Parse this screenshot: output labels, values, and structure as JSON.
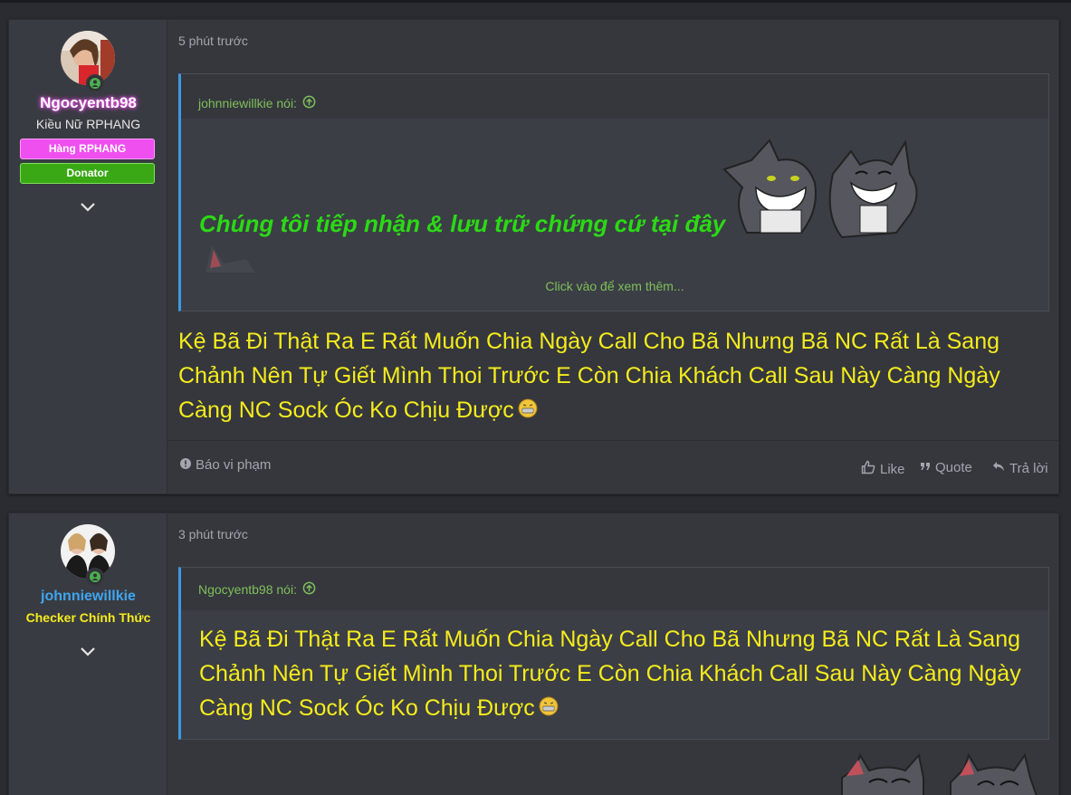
{
  "post1": {
    "time": "5 phút trước",
    "user": {
      "name": "Ngocyentb98",
      "title": "Kiều Nữ RPHANG",
      "banners": [
        "Hàng RPHANG",
        "Donator"
      ]
    },
    "quote": {
      "author": "johnniewillkie nói:",
      "text": "Chúng tôi tiếp nhận & lưu trữ chứng cứ tại đây",
      "expand": "Click vào để xem thêm..."
    },
    "body": "Kệ Bã Đi Thật Ra E Rất Muốn Chia Ngày Call Cho Bã Nhưng Bã NC Rất Là Sang Chảnh Nên Tự Giết Mình Thoi Trước E Còn Chia Khách Call Sau Này Càng Ngày Càng NC Sock Óc Ko Chịu Được",
    "actions": {
      "report": "Báo vi phạm",
      "like": "Like",
      "quote": "Quote",
      "reply": "Trả lời"
    }
  },
  "post2": {
    "time": "3 phút trước",
    "user": {
      "name": "johnniewillkie",
      "title": "Checker Chính Thức"
    },
    "quote": {
      "author": "Ngocyentb98 nói:",
      "text": "Kệ Bã Đi Thật Ra E Rất Muốn Chia Ngày Call Cho Bã Nhưng Bã NC Rất Là Sang Chảnh Nên Tự Giết Mình Thoi Trước E Còn Chia Khách Call Sau Này Càng Ngày Càng NC Sock Óc Ko Chịu Được"
    }
  },
  "colors": {
    "accent_blue": "#3c9ae3",
    "quote_author": "#7fbf5a",
    "post_text": "#f5ec1c",
    "green_text": "#2bd915",
    "pink_name": "#f08cf0",
    "blue_name": "#3ea5f0",
    "banner_pink": "#f04ff0",
    "banner_green": "#3aa815",
    "title_yellow": "#f5ec1c"
  }
}
